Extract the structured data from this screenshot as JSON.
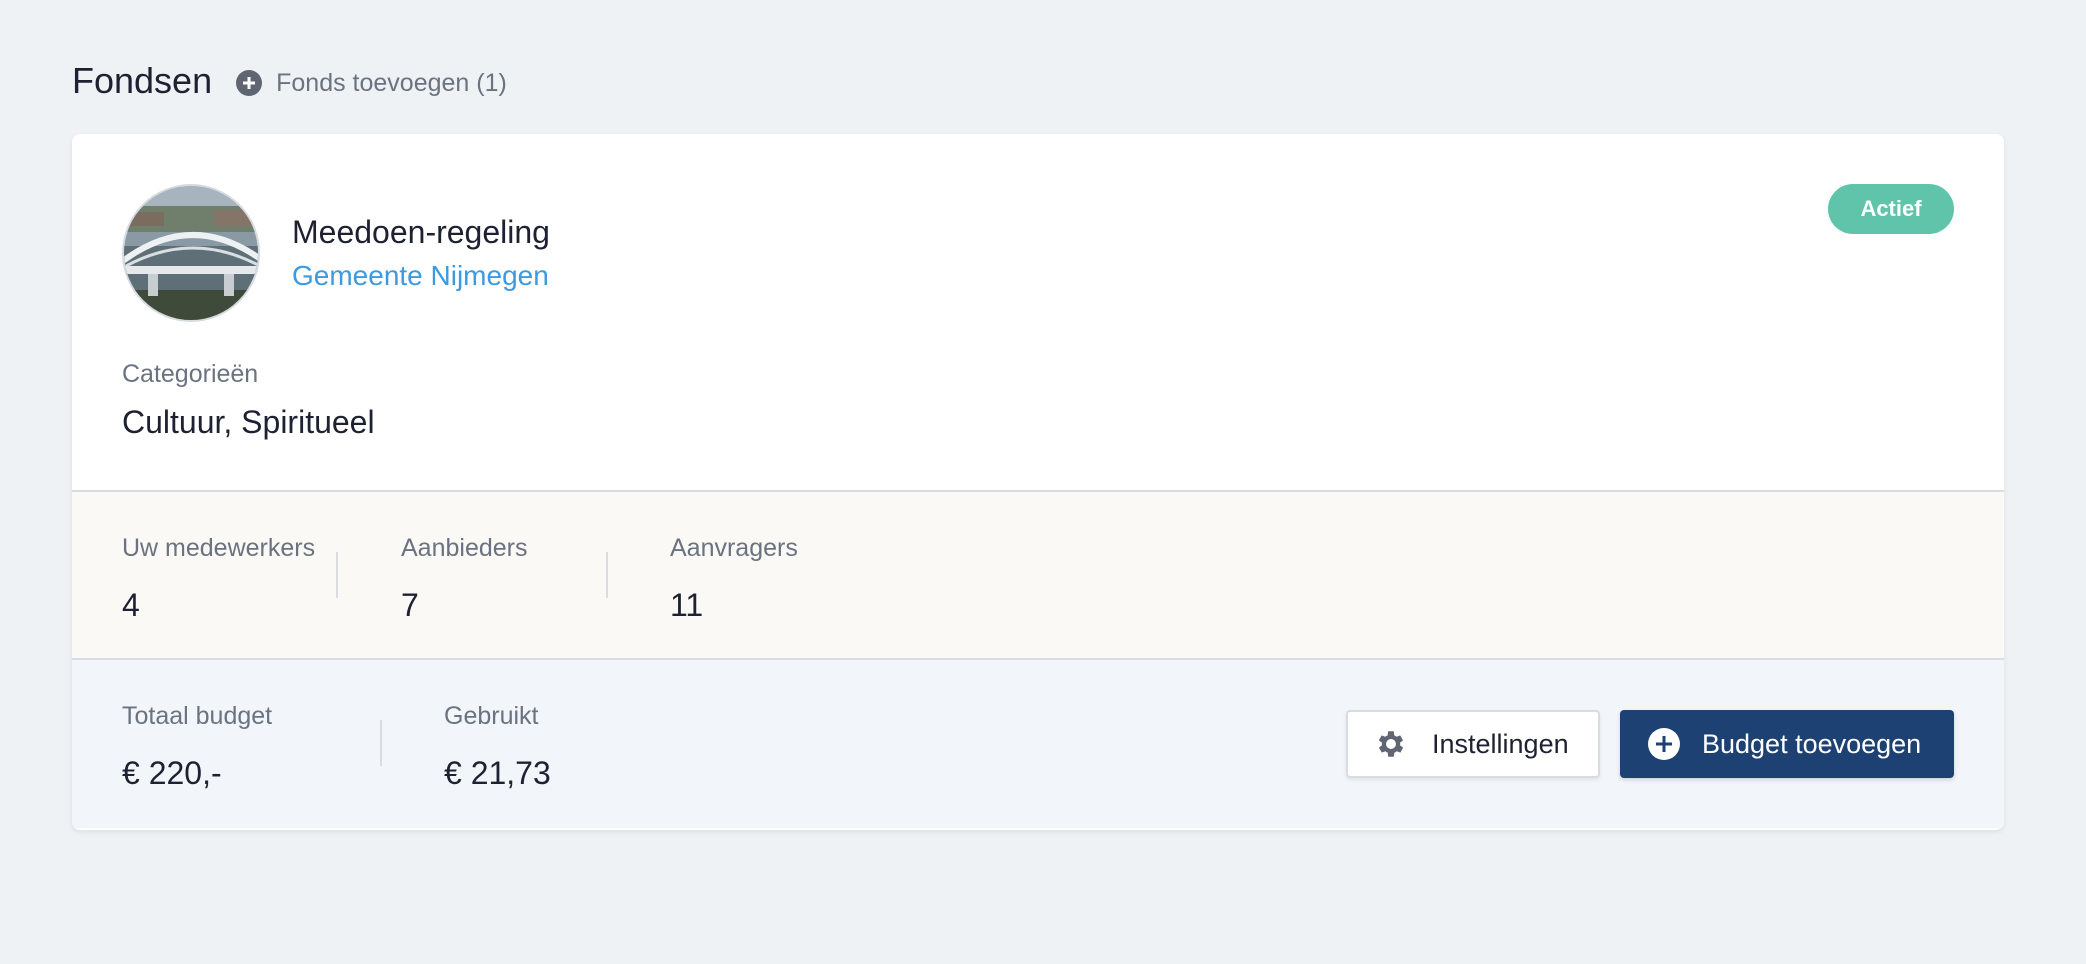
{
  "header": {
    "title": "Fondsen",
    "add_fund_label": "Fonds toevoegen (1)",
    "add_icon": "plus-circle-icon"
  },
  "fund": {
    "name": "Meedoen-regeling",
    "organization": "Gemeente Nijmegen",
    "status": "Actief",
    "status_color": "#5fc4a9",
    "image": "bridge-photo",
    "categories_label": "Categorieën",
    "categories_value": "Cultuur, Spiritueel"
  },
  "stats": [
    {
      "label": "Uw medewerkers",
      "value": "4"
    },
    {
      "label": "Aanbieders",
      "value": "7"
    },
    {
      "label": "Aanvragers",
      "value": "11"
    }
  ],
  "budget": {
    "total_label": "Totaal budget",
    "total_value": "€ 220,-",
    "used_label": "Gebruikt",
    "used_value": "€ 21,73"
  },
  "actions": {
    "settings_label": "Instellingen",
    "settings_icon": "gear-icon",
    "add_budget_label": "Budget toevoegen",
    "add_budget_icon": "plus-circle-icon",
    "primary_color": "#1e4173"
  }
}
